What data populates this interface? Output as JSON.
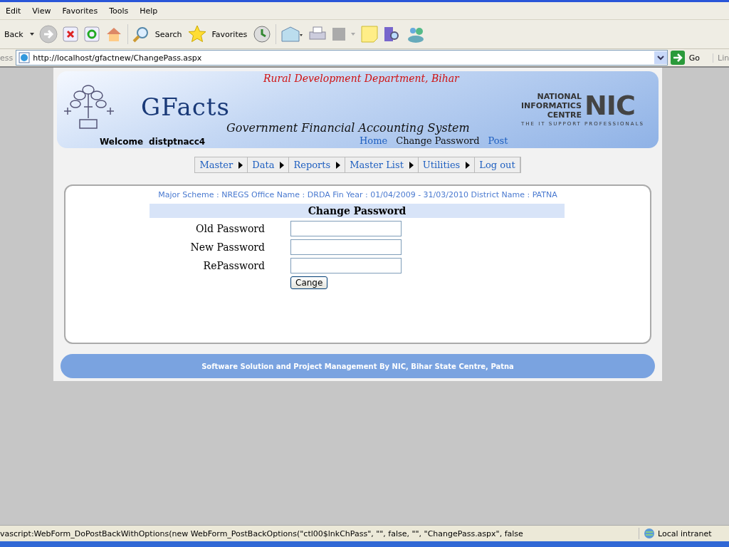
{
  "browser": {
    "menu": [
      "Edit",
      "View",
      "Favorites",
      "Tools",
      "Help"
    ],
    "toolbar": {
      "back": "Back",
      "search": "Search",
      "favorites": "Favorites"
    },
    "address": {
      "label": "ess",
      "url": "http://localhost/gfactnew/ChangePass.aspx",
      "go": "Go",
      "links": "Lin"
    }
  },
  "header": {
    "department": "Rural Development Department, Bihar",
    "app_name": "GFacts",
    "subtitle": "Government Financial Accounting System",
    "welcome_label": "Welcome",
    "user": "distptnacc4",
    "logo": {
      "line1": "NATIONAL",
      "line2": "INFORMATICS",
      "line3": "CENTRE",
      "mark": "NIC",
      "tagline": "THE IT SUPPORT PROFESSIONALS"
    },
    "links": [
      {
        "label": "Home",
        "selected": false
      },
      {
        "label": "Change Password",
        "selected": true
      },
      {
        "label": "Post",
        "selected": false
      }
    ]
  },
  "menu": [
    {
      "label": "Master",
      "has_submenu": true
    },
    {
      "label": "Data",
      "has_submenu": true
    },
    {
      "label": "Reports",
      "has_submenu": true
    },
    {
      "label": "Master List",
      "has_submenu": true
    },
    {
      "label": "Utilities",
      "has_submenu": true
    },
    {
      "label": "Log out",
      "has_submenu": false
    }
  ],
  "info": "Major Scheme : NREGS Office Name : DRDA Fin Year : 01/04/2009 - 31/03/2010 District Name : PATNA",
  "form": {
    "title": "Change Password",
    "fields": [
      {
        "label": "Old Password"
      },
      {
        "label": "New Password"
      },
      {
        "label": "RePassword"
      }
    ],
    "button": "Cange"
  },
  "footer": "Software Solution and Project Management By NIC, Bihar State Centre, Patna",
  "status_bar": {
    "text": "vascript:WebForm_DoPostBackWithOptions(new WebForm_PostBackOptions(\"ctl00$lnkChPass\", \"\", false, \"\", \"ChangePass.aspx\", false",
    "zone": "Local intranet"
  }
}
